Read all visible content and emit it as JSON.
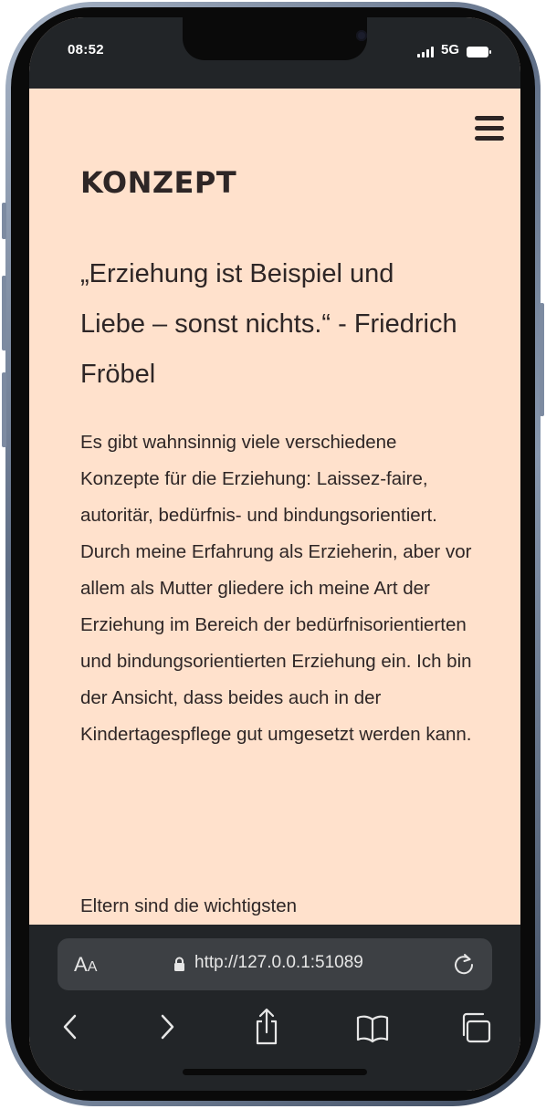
{
  "status_bar": {
    "time": "08:52",
    "network": "5G"
  },
  "page": {
    "title": "KONZEPT",
    "quote": "„Erziehung ist Beispiel und Liebe – sonst nichts.“ - Friedrich Fröbel",
    "paragraphs": [
      "Es gibt wahnsinnig viele verschiedene Konzepte für die Erziehung: Laissez-faire, autoritär, bedürfnis- und bindungsorientiert. Durch meine Erfahrung als Erzieherin, aber vor allem als Mutter gliedere ich meine Art der Erziehung im Bereich der bedürfnisorientierten und bindungsorientierten Erziehung ein. Ich bin der Ansicht, dass beides auch in der Kindertagespflege gut umgesetzt werden kann.",
      "Eltern sind die wichtigsten"
    ]
  },
  "browser": {
    "aa_label_big": "A",
    "aa_label_small": "A",
    "url": "http://127.0.0.1:51089"
  },
  "icons": {
    "menu": "hamburger-menu-icon",
    "lock": "lock-icon",
    "reload": "reload-icon",
    "back": "chevron-left-icon",
    "forward": "chevron-right-icon",
    "share": "share-icon",
    "bookmarks": "book-icon",
    "tabs": "tabs-icon"
  },
  "colors": {
    "page_background": "#ffe1cc",
    "text": "#2e2626",
    "browser_chrome": "#222528",
    "url_field": "#3d4044"
  }
}
